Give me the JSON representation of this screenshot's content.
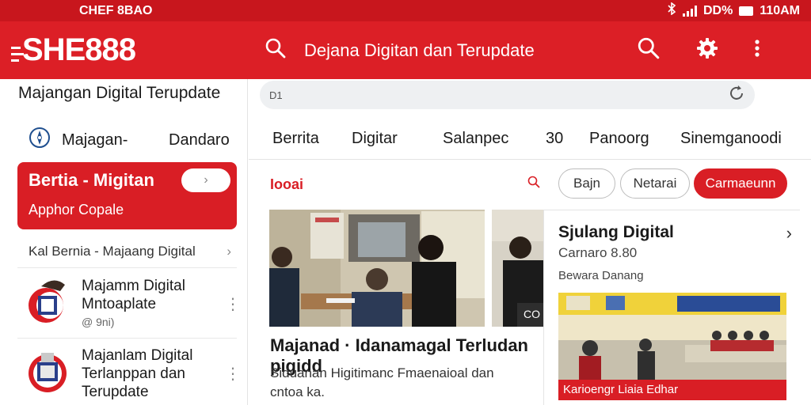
{
  "status_bar": {
    "carrier": "CHEF 8BAO",
    "battery": "DD%",
    "time": "110AM"
  },
  "app_bar": {
    "logo": "SHE888",
    "title": "Dejana Digitan dan Terupdate"
  },
  "sidebar": {
    "title": "Majangan Digital Terupdate",
    "tabs": [
      "Majagan-",
      "Dandaro"
    ],
    "promo": {
      "title": "Bertia - Migitan",
      "subtitle": "Apphor Copale"
    },
    "breadcrumb": "Kal Bernia - Majaang Digital",
    "items": [
      {
        "title": "Majamm Digital Mntoaplate",
        "meta": "@ 9ni)"
      },
      {
        "title": "Majanlam Digital Terlanppan dan Terupdate"
      }
    ]
  },
  "main": {
    "search_label": "D1",
    "tabs": [
      "Berrita",
      "Digitar",
      "Salanpec",
      "30",
      "Panoorg",
      "Sinemganoodi"
    ],
    "section_label": "Iooai",
    "chips": [
      "Bajn",
      "Netarai",
      "Carmaeunn"
    ],
    "photo_badge": "CO",
    "headline": "Majanad · Idanamagal Terludan pigidd",
    "subtext": "Siduanan Higitimanc Fmaenaioal dan cntoa ka.",
    "card": {
      "title": "Sjulang Digital",
      "subtitle": "Carnaro 8.80",
      "body": "Bewara Danang",
      "caption": "Karioengr Liaia Edhar"
    }
  },
  "colors": {
    "brand": "#dc1f26",
    "status": "#c8161d",
    "accent": "#d91e25"
  },
  "icons": [
    "bluetooth-icon",
    "signal-icon",
    "battery-icon",
    "search-icon",
    "gear-icon",
    "more-vert-icon",
    "refresh-icon",
    "chevron-right-icon"
  ]
}
